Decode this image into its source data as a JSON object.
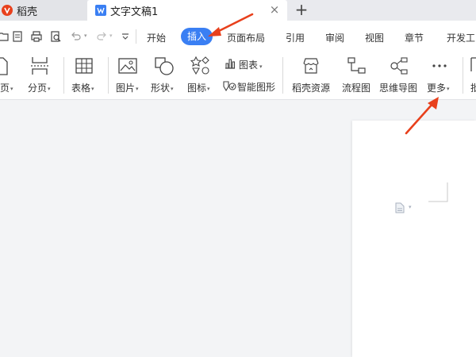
{
  "tabs": {
    "inactive": {
      "label": "稻壳"
    },
    "active": {
      "label": "文字文稿1"
    },
    "close_symbol": "×",
    "new_symbol": "+"
  },
  "menu": {
    "items": [
      "开始",
      "插入",
      "页面布局",
      "引用",
      "审阅",
      "视图",
      "章节",
      "开发工"
    ],
    "active_item": "插入",
    "accent_color": "#3a7ff3"
  },
  "ribbon": {
    "page_break_partial": "页",
    "page_break": "分页",
    "table": "表格",
    "picture": "图片",
    "shape": "形状",
    "icon": "图标",
    "chart": "图表",
    "smart_graphic": "智能图形",
    "daoke_resources": "稻壳资源",
    "flowchart": "流程图",
    "mindmap": "思维导图",
    "more": "更多",
    "right_partial": "批"
  },
  "annotation_color": "#e8401c"
}
